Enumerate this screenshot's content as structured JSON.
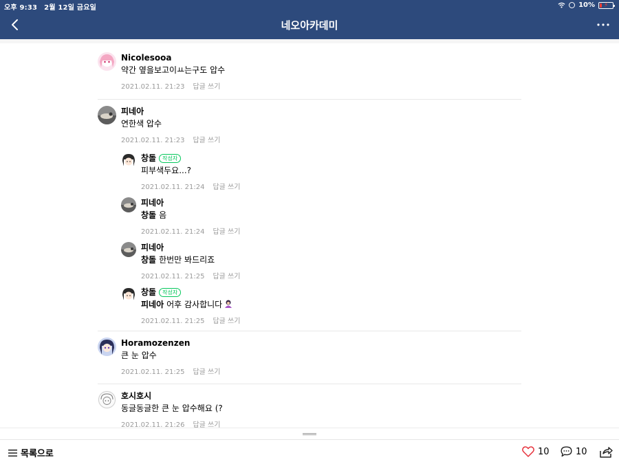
{
  "status_bar": {
    "time": "오후 9:33",
    "date": "2월 12일 금요일",
    "battery": "10%"
  },
  "header": {
    "title": "네오아카데미"
  },
  "comments": [
    {
      "author": "Nicolesooa",
      "text": "약간 옆을보고이ㅛ는구도 압수",
      "date": "2021.02.11. 21:23",
      "reply_label": "답글 쓰기"
    },
    {
      "author": "피네아",
      "text": "연한색 압수",
      "date": "2021.02.11. 21:23",
      "reply_label": "답글 쓰기"
    },
    {
      "author": "창돌",
      "badge": "작성자",
      "text": "피부색두요...?",
      "date": "2021.02.11. 21:24",
      "reply_label": "답글 쓰기"
    },
    {
      "author": "피네아",
      "mention": "창돌",
      "text": "음",
      "date": "2021.02.11. 21:24",
      "reply_label": "답글 쓰기"
    },
    {
      "author": "피네아",
      "mention": "창돌",
      "text": "한번만 봐드리죠",
      "date": "2021.02.11. 21:25",
      "reply_label": "답글 쓰기"
    },
    {
      "author": "창돌",
      "badge": "작성자",
      "mention": "피네아",
      "text": "어후 감사합니다",
      "date": "2021.02.11. 21:25",
      "reply_label": "답글 쓰기"
    },
    {
      "author": "Horamozenzen",
      "text": "큰 눈 압수",
      "date": "2021.02.11. 21:25",
      "reply_label": "답글 쓰기"
    },
    {
      "author": "호시호시",
      "text": "동글동글한 큰 눈 압수해요 (?",
      "date": "2021.02.11. 21:26",
      "reply_label": "답글 쓰기"
    }
  ],
  "bottom_bar": {
    "list_label": "목록으로",
    "like_count": "10",
    "comment_count": "10"
  },
  "colors": {
    "header_bg": "#2d4a7c",
    "writer_badge": "#03c75a"
  },
  "icons": [
    "back-icon",
    "more-icon",
    "wifi-icon",
    "battery-icon",
    "list-icon",
    "heart-icon",
    "comment-bubble-icon",
    "share-icon"
  ]
}
